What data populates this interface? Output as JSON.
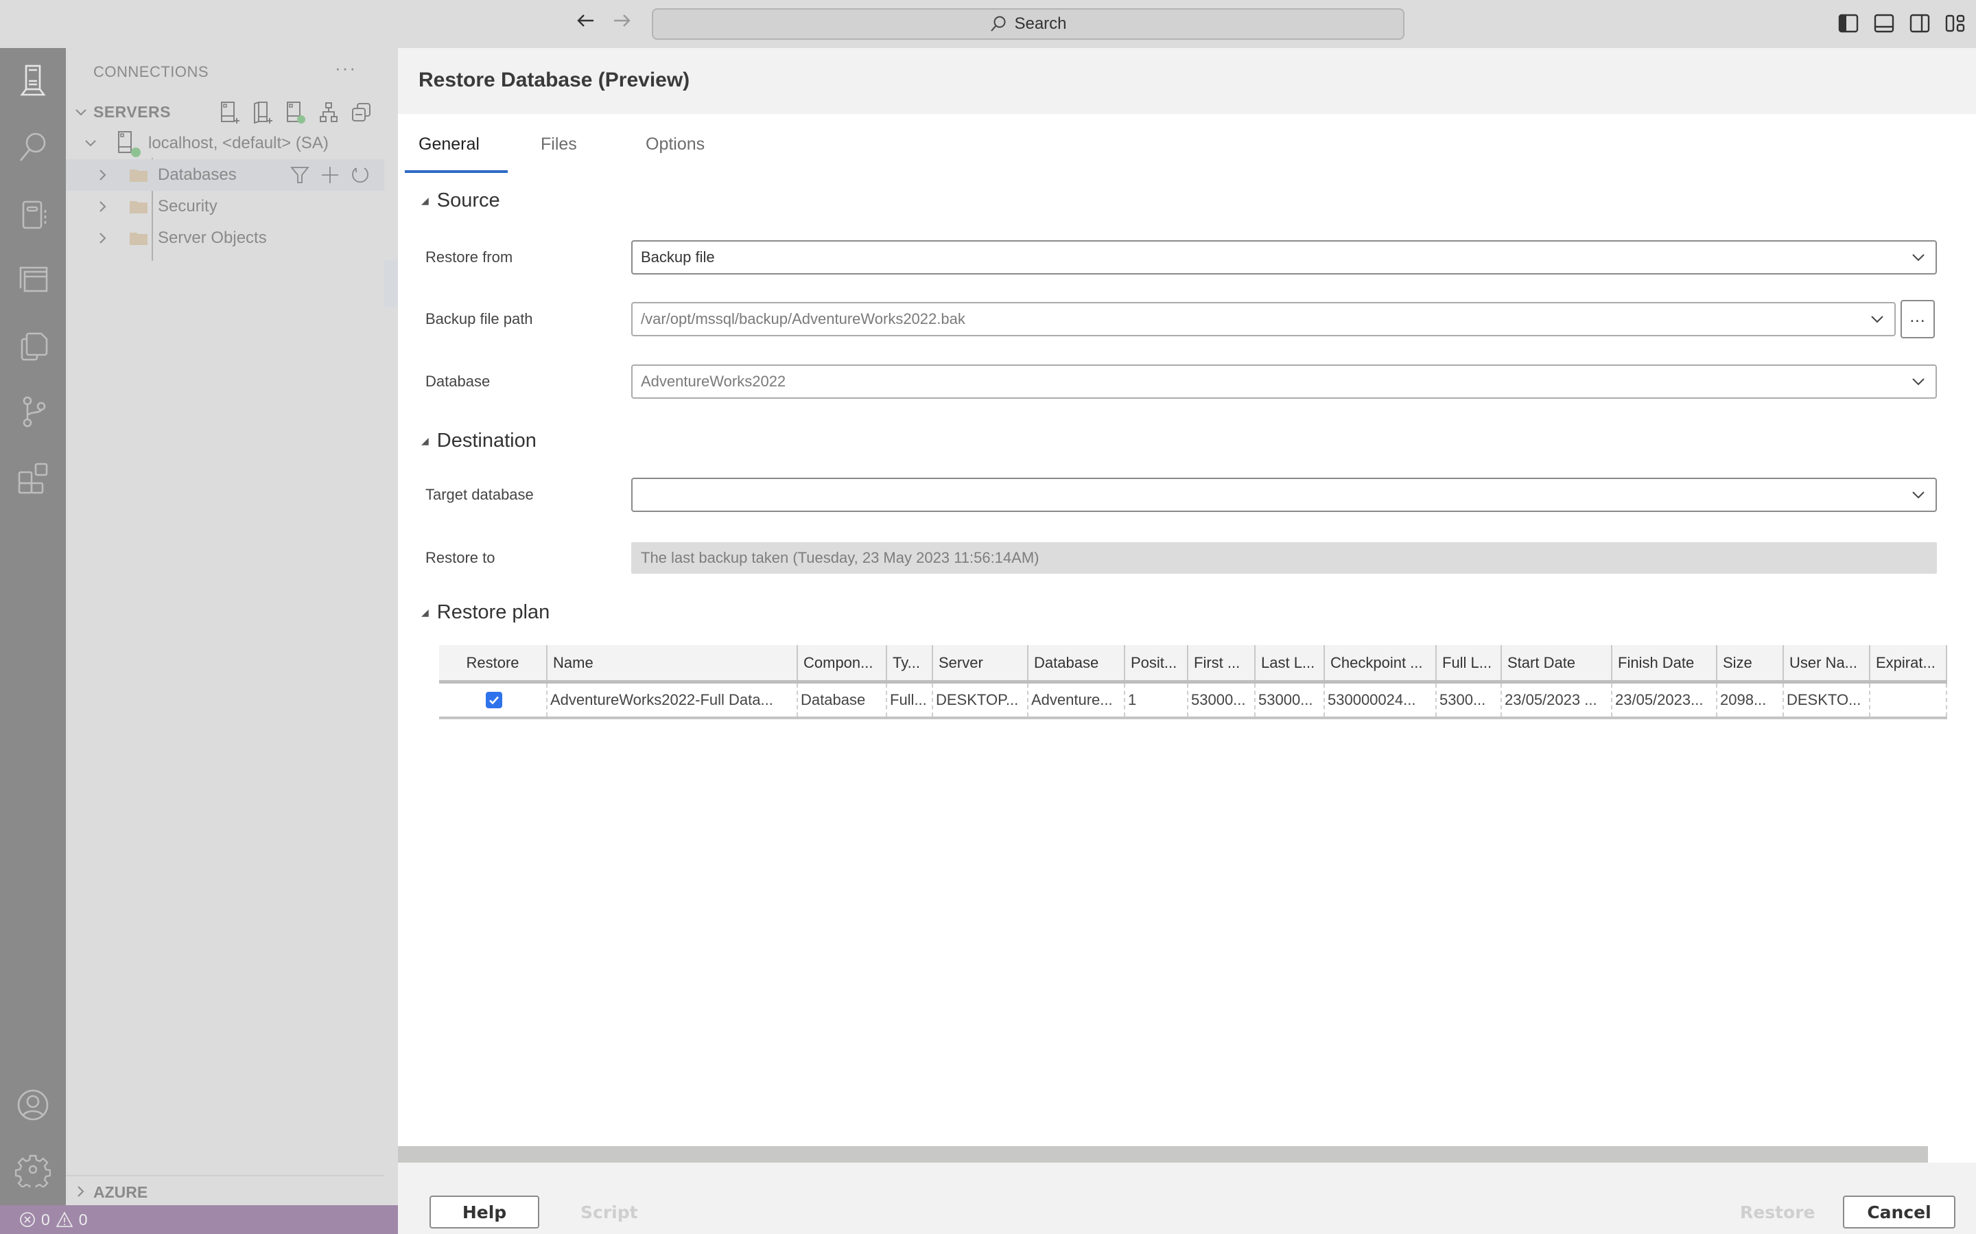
{
  "titlebar": {
    "search_label": "Search",
    "icons": [
      "arrow-left-icon",
      "arrow-right-icon",
      "toggle-primary-sidebar-icon",
      "toggle-panel-icon",
      "toggle-secondary-sidebar-icon",
      "customize-layout-icon"
    ]
  },
  "activitybar": {
    "items": [
      "connections",
      "search",
      "notebooks",
      "query-history",
      "explorer",
      "source-control",
      "extensions"
    ],
    "bottom_items": [
      "accounts",
      "manage"
    ]
  },
  "sidebar": {
    "title": "CONNECTIONS",
    "more_label": "···",
    "servers_section": "SERVERS",
    "server": {
      "label": "localhost, <default> (SA)",
      "status_color": "#8fc293",
      "children": [
        {
          "label": "Databases"
        },
        {
          "label": "Security"
        },
        {
          "label": "Server Objects"
        }
      ]
    },
    "azure_section": "AZURE"
  },
  "statusbar": {
    "errors": "0",
    "warnings": "0",
    "color": "#a088a8"
  },
  "dialog": {
    "title": "Restore Database (Preview)",
    "tabs": [
      {
        "label": "General",
        "active": true
      },
      {
        "label": "Files",
        "active": false
      },
      {
        "label": "Options",
        "active": false
      }
    ],
    "source": {
      "heading": "Source",
      "restore_from_label": "Restore from",
      "restore_from_value": "Backup file",
      "backup_path_label": "Backup file path",
      "backup_path_value": "/var/opt/mssql/backup/AdventureWorks2022.bak",
      "browse_label": "...",
      "database_label": "Database",
      "database_value": "AdventureWorks2022"
    },
    "destination": {
      "heading": "Destination",
      "target_label": "Target database",
      "target_value": "",
      "restore_to_label": "Restore to",
      "restore_to_value": "The last backup taken (Tuesday, 23 May 2023 11:56:14AM)"
    },
    "plan": {
      "heading": "Restore plan",
      "columns": [
        "Restore",
        "Name",
        "Compon...",
        "Ty...",
        "Server",
        "Database",
        "Posit...",
        "First ...",
        "Last L...",
        "Checkpoint ...",
        "Full L...",
        "Start Date",
        "Finish Date",
        "Size",
        "User Na...",
        "Expirat..."
      ],
      "rows": [
        {
          "checked": true,
          "cells": [
            "",
            "AdventureWorks2022-Full Data...",
            "Database",
            "Full...",
            "DESKTOP...",
            "Adventure...",
            "1",
            "53000...",
            "53000...",
            "530000024...",
            "5300...",
            "23/05/2023 ...",
            "23/05/2023...",
            "2098...",
            "DESKTO...",
            ""
          ]
        }
      ]
    },
    "footer": {
      "help": "Help",
      "script": "Script",
      "restore": "Restore",
      "cancel": "Cancel"
    },
    "accent_color": "#2f6bc5",
    "checkbox_color": "#2f73ec"
  }
}
